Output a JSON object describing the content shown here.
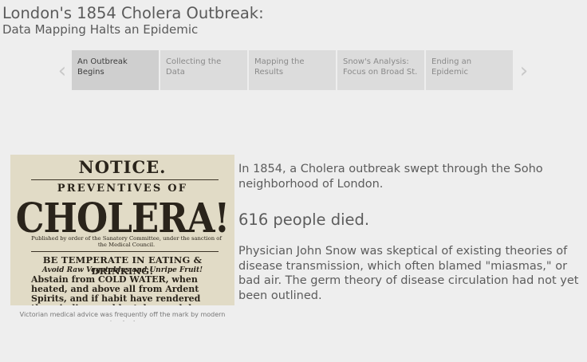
{
  "header": {
    "title": "London's 1854 Cholera Outbreak:",
    "subtitle": "Data Mapping Halts an Epidemic"
  },
  "nav": {
    "prev_icon": "chevron-left-icon",
    "next_icon": "chevron-right-icon",
    "active_index": 0,
    "tabs": [
      {
        "label": "An Outbreak Begins"
      },
      {
        "label": "Collecting the Data"
      },
      {
        "label": "Mapping the Results"
      },
      {
        "label": "Snow's Analysis: Focus on Broad St."
      },
      {
        "label": "Ending an Epidemic"
      }
    ]
  },
  "figure": {
    "poster": {
      "notice": "NOTICE.",
      "preventives": "PREVENTIVES OF",
      "cholera": "CHOLERA!",
      "published": "Published by order of the Sanatory Committee, under the sanction of the Medical Council.",
      "temperate": "BE TEMPERATE IN EATING & DRINKING!",
      "avoid": "Avoid Raw Vegetables and Unripe Fruit!",
      "abstain": "Abstain from COLD WATER, when heated, and above all from Ardent Spirits, and if habit have rendered them indispensable, take much less than usual."
    },
    "caption": "Victorian medical advice was frequently off the mark by modern standards"
  },
  "content": {
    "para1": "In 1854, a Cholera outbreak swept through the Soho neighborhood of London.",
    "deaths": "616 people died.",
    "para2": "Physician John Snow was skeptical of existing theories of disease transmission, which often blamed \"miasmas,\" or bad air. The germ theory of disease circulation had not yet been outlined."
  }
}
